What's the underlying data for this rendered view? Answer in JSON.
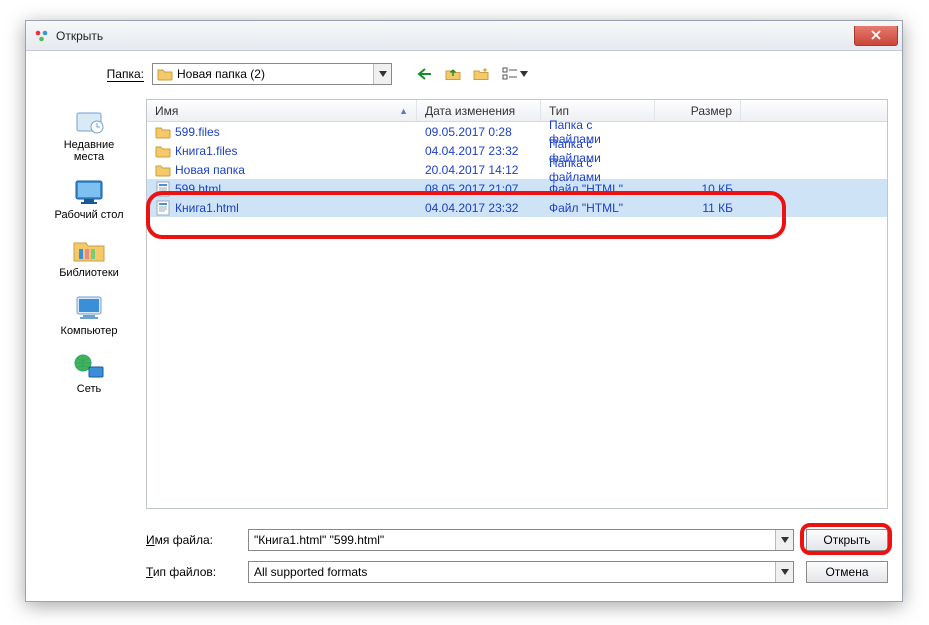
{
  "dialog": {
    "title": "Открыть"
  },
  "folder_bar": {
    "label": "Папка:",
    "label_underline": "П",
    "current": "Новая папка (2)"
  },
  "places": [
    {
      "key": "recent",
      "label": "Недавние\nместа"
    },
    {
      "key": "desktop",
      "label": "Рабочий стол"
    },
    {
      "key": "libraries",
      "label": "Библиотеки"
    },
    {
      "key": "computer",
      "label": "Компьютер"
    },
    {
      "key": "network",
      "label": "Сеть"
    }
  ],
  "columns": {
    "name": "Имя",
    "date": "Дата изменения",
    "type": "Тип",
    "size": "Размер"
  },
  "rows": [
    {
      "icon": "folder",
      "name": "599.files",
      "date": "09.05.2017 0:28",
      "type": "Папка с файлами",
      "size": "",
      "selected": false
    },
    {
      "icon": "folder",
      "name": "Книга1.files",
      "date": "04.04.2017 23:32",
      "type": "Папка с файлами",
      "size": "",
      "selected": false
    },
    {
      "icon": "folder",
      "name": "Новая папка",
      "date": "20.04.2017 14:12",
      "type": "Папка с файлами",
      "size": "",
      "selected": false
    },
    {
      "icon": "html",
      "name": "599.html",
      "date": "08.05.2017 21:07",
      "type": "Файл \"HTML\"",
      "size": "10 КБ",
      "selected": true
    },
    {
      "icon": "html",
      "name": "Книга1.html",
      "date": "04.04.2017 23:32",
      "type": "Файл \"HTML\"",
      "size": "11 КБ",
      "selected": true
    }
  ],
  "filename": {
    "label_pre": "",
    "label_u": "И",
    "label_post": "мя файла:",
    "value": "\"Книга1.html\" \"599.html\""
  },
  "filetype": {
    "label_pre": "",
    "label_u": "Т",
    "label_post": "ип файлов:",
    "value": "All supported formats"
  },
  "buttons": {
    "open": "Открыть",
    "cancel": "Отмена"
  }
}
